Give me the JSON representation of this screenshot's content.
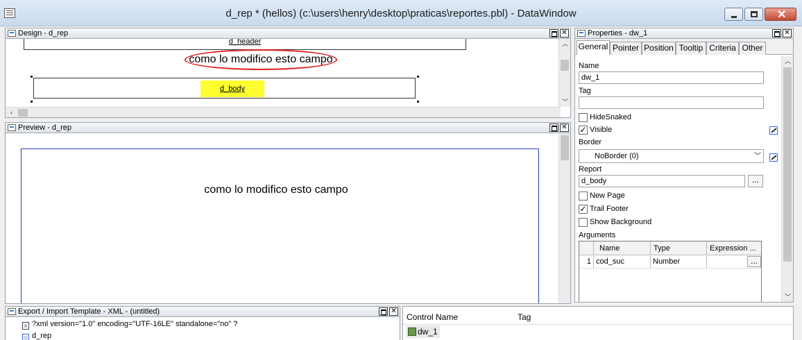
{
  "window": {
    "title": "d_rep * (hellos) (c:\\users\\henry\\desktop\\praticas\\reportes.pbl) - DataWindow"
  },
  "design": {
    "title": "Design - d_rep",
    "header_band": "d_header",
    "text_field": "como lo modifico esto campo",
    "body_label": "d_body"
  },
  "preview": {
    "title": "Preview - d_rep",
    "text": "como lo modifico esto campo"
  },
  "properties": {
    "title": "Properties - dw_1",
    "tabs": [
      {
        "label": "General",
        "active": true
      },
      {
        "label": "Pointer"
      },
      {
        "label": "Position"
      },
      {
        "label": "Tooltip"
      },
      {
        "label": "Criteria"
      },
      {
        "label": "Other"
      }
    ],
    "name_label": "Name",
    "name_value": "dw_1",
    "tag_label": "Tag",
    "tag_value": "",
    "hidesnaked_label": "HideSnaked",
    "hidesnaked_checked": false,
    "visible_label": "Visible",
    "visible_checked": true,
    "border_label": "Border",
    "border_value": "NoBorder (0)",
    "report_label": "Report",
    "report_value": "d_body",
    "dots_label": "...",
    "newpage_label": "New Page",
    "newpage_checked": false,
    "trailfooter_label": "Trail Footer",
    "trailfooter_checked": true,
    "showbg_label": "Show Background",
    "showbg_checked": false,
    "arguments_label": "Arguments",
    "arguments": {
      "columns": [
        "Name",
        "Type",
        "Expression ..."
      ],
      "rows": [
        {
          "num": "1",
          "name": "cod_suc",
          "type": "Number",
          "expression": "",
          "dots": "..."
        }
      ]
    }
  },
  "export": {
    "title": "Export / Import Template - XML - (untitled)",
    "items": [
      {
        "icon": "x",
        "text": "?xml version=\"1.0\" encoding=\"UTF-16LE\" standalone=\"no\" ?"
      },
      {
        "icon": "",
        "text": "d_rep"
      }
    ]
  },
  "controls": {
    "columns": [
      "Control Name",
      "Tag"
    ],
    "rows": [
      {
        "name": "dw_1",
        "tag": ""
      }
    ]
  },
  "colors": {
    "highlight": "#ffff30",
    "annotation": "#e02020",
    "preview_border": "#1f3fb0"
  }
}
